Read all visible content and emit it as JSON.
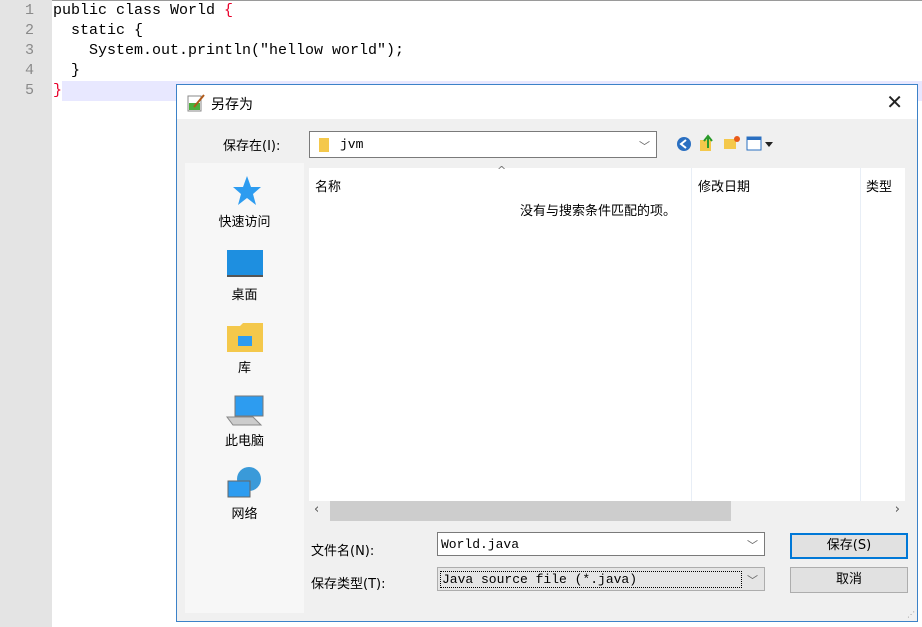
{
  "editor": {
    "line_numbers": [
      "1",
      "2",
      "3",
      "4",
      "5"
    ],
    "lines": [
      {
        "text": "public class World ",
        "brace": "{"
      },
      {
        "text": "  static {"
      },
      {
        "text": "    System.out.println(\"hellow world\");"
      },
      {
        "text": "  }"
      },
      {
        "text": "",
        "brace": "}"
      }
    ],
    "brace_color": "#e8002a"
  },
  "dialog": {
    "title": "另存为",
    "save_in_label": "保存在(I):",
    "save_in_value": "jvm",
    "places": [
      "快速访问",
      "桌面",
      "库",
      "此电脑",
      "网络"
    ],
    "columns": [
      "名称",
      "修改日期",
      "类型"
    ],
    "empty_message": "没有与搜索条件匹配的项。",
    "filename_label": "文件名(N):",
    "filename_value": "World.java",
    "filetype_label": "保存类型(T):",
    "filetype_value": "Java source file (*.java)",
    "save_button": "保存(S)",
    "cancel_button": "取消",
    "accent": "#0078d7"
  }
}
